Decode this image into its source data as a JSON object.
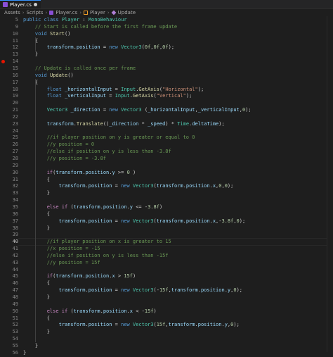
{
  "tab": {
    "label": "Player.cs"
  },
  "breadcrumb": {
    "items": [
      "Assets",
      "Scripts",
      "Player.cs",
      "Player",
      "Update"
    ]
  },
  "active_line": "40",
  "breakpoint_line": "14",
  "lines": [
    {
      "n": "5",
      "code": "public class Player : MonoBehaviour"
    },
    {
      "n": "9",
      "code": "    // Start is called before the first frame update"
    },
    {
      "n": "10",
      "code": "    void Start()"
    },
    {
      "n": "11",
      "code": "    {"
    },
    {
      "n": "12",
      "code": "        transform.position = new Vector3(0f,0f,0f);"
    },
    {
      "n": "13",
      "code": "    }"
    },
    {
      "n": "14",
      "code": ""
    },
    {
      "n": "15",
      "code": "    // Update is called once per frame"
    },
    {
      "n": "16",
      "code": "    void Update()"
    },
    {
      "n": "17",
      "code": "    {"
    },
    {
      "n": "18",
      "code": "        float _horizontalInput = Input.GetAxis(\"Horizontal\");"
    },
    {
      "n": "19",
      "code": "        float _verticalInput = Input.GetAxis(\"Vertical\");"
    },
    {
      "n": "20",
      "code": ""
    },
    {
      "n": "21",
      "code": "        Vector3 _direction = new Vector3 (_horizontalInput,_verticalInput,0);"
    },
    {
      "n": "22",
      "code": ""
    },
    {
      "n": "23",
      "code": "        transform.Translate((_direction * _speed) * Time.deltaTime);"
    },
    {
      "n": "24",
      "code": ""
    },
    {
      "n": "25",
      "code": "        //if player position on y is greater or equal to 0"
    },
    {
      "n": "26",
      "code": "        //y position = 0"
    },
    {
      "n": "27",
      "code": "        //else if position on y is less than -3.8f"
    },
    {
      "n": "28",
      "code": "        //y position = -3.8f"
    },
    {
      "n": "29",
      "code": ""
    },
    {
      "n": "30",
      "code": "        if(transform.position.y >= 0 )"
    },
    {
      "n": "31",
      "code": "        {"
    },
    {
      "n": "32",
      "code": "            transform.position = new Vector3(transform.position.x,0,0);"
    },
    {
      "n": "33",
      "code": "        }"
    },
    {
      "n": "34",
      "code": ""
    },
    {
      "n": "35",
      "code": "        else if (transform.position.y <= -3.8f)"
    },
    {
      "n": "36",
      "code": "        {"
    },
    {
      "n": "37",
      "code": "            transform.position = new Vector3(transform.position.x,-3.8f,0);"
    },
    {
      "n": "38",
      "code": "        }"
    },
    {
      "n": "39",
      "code": ""
    },
    {
      "n": "40",
      "code": "        //if player position on x is greater to 15"
    },
    {
      "n": "41",
      "code": "        //x position = -15"
    },
    {
      "n": "42",
      "code": "        //else if position on y is less than -15f"
    },
    {
      "n": "43",
      "code": "        //y position = 15f"
    },
    {
      "n": "44",
      "code": ""
    },
    {
      "n": "45",
      "code": "        if(transform.position.x > 15f)"
    },
    {
      "n": "46",
      "code": "        {"
    },
    {
      "n": "47",
      "code": "            transform.position = new Vector3(-15f,transform.position.y,0);"
    },
    {
      "n": "48",
      "code": "        }"
    },
    {
      "n": "49",
      "code": ""
    },
    {
      "n": "50",
      "code": "        else if (transform.position.x < -15f)"
    },
    {
      "n": "51",
      "code": "        {"
    },
    {
      "n": "52",
      "code": "            transform.position = new Vector3(15f,transform.position.y,0);"
    },
    {
      "n": "53",
      "code": "        }"
    },
    {
      "n": "54",
      "code": ""
    },
    {
      "n": "55",
      "code": "    }"
    },
    {
      "n": "56",
      "code": "}"
    }
  ],
  "colors": {
    "background": "#1e1e1e",
    "keyword": "#569cd6",
    "type": "#4ec9b0",
    "method": "#dcdcaa",
    "string": "#ce9178",
    "comment": "#6a9955",
    "number": "#b5cea8",
    "variable": "#9cdcfe",
    "control": "#c586c0",
    "breakpoint": "#e51400",
    "line_number": "#858585"
  }
}
